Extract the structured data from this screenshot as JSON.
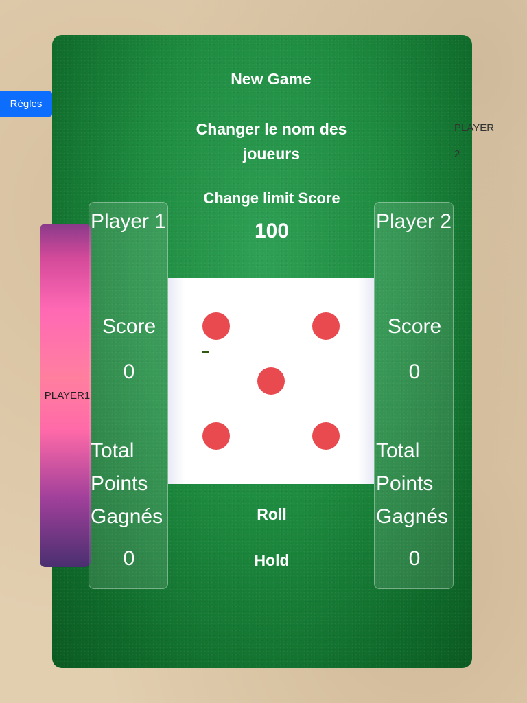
{
  "menu": {
    "new_game": "New Game",
    "rename_players": "Changer le nom des joueurs",
    "change_limit": "Change limit Score",
    "limit_value": "100"
  },
  "rules_button": "Règles",
  "player2_tag": "PLAYER 2",
  "player1_indicator": "PLAYER1",
  "player1": {
    "name": "Player 1",
    "score_label": "Score",
    "score": "0",
    "total_label": "Total Points Gagnés",
    "total": "0"
  },
  "player2": {
    "name": "Player 2",
    "score_label": "Score",
    "score": "0",
    "total_label": "Total Points Gagnés",
    "total": "0"
  },
  "die": {
    "face": 5,
    "pip_color": "#e84a4f"
  },
  "actions": {
    "roll": "Roll",
    "hold": "Hold"
  }
}
